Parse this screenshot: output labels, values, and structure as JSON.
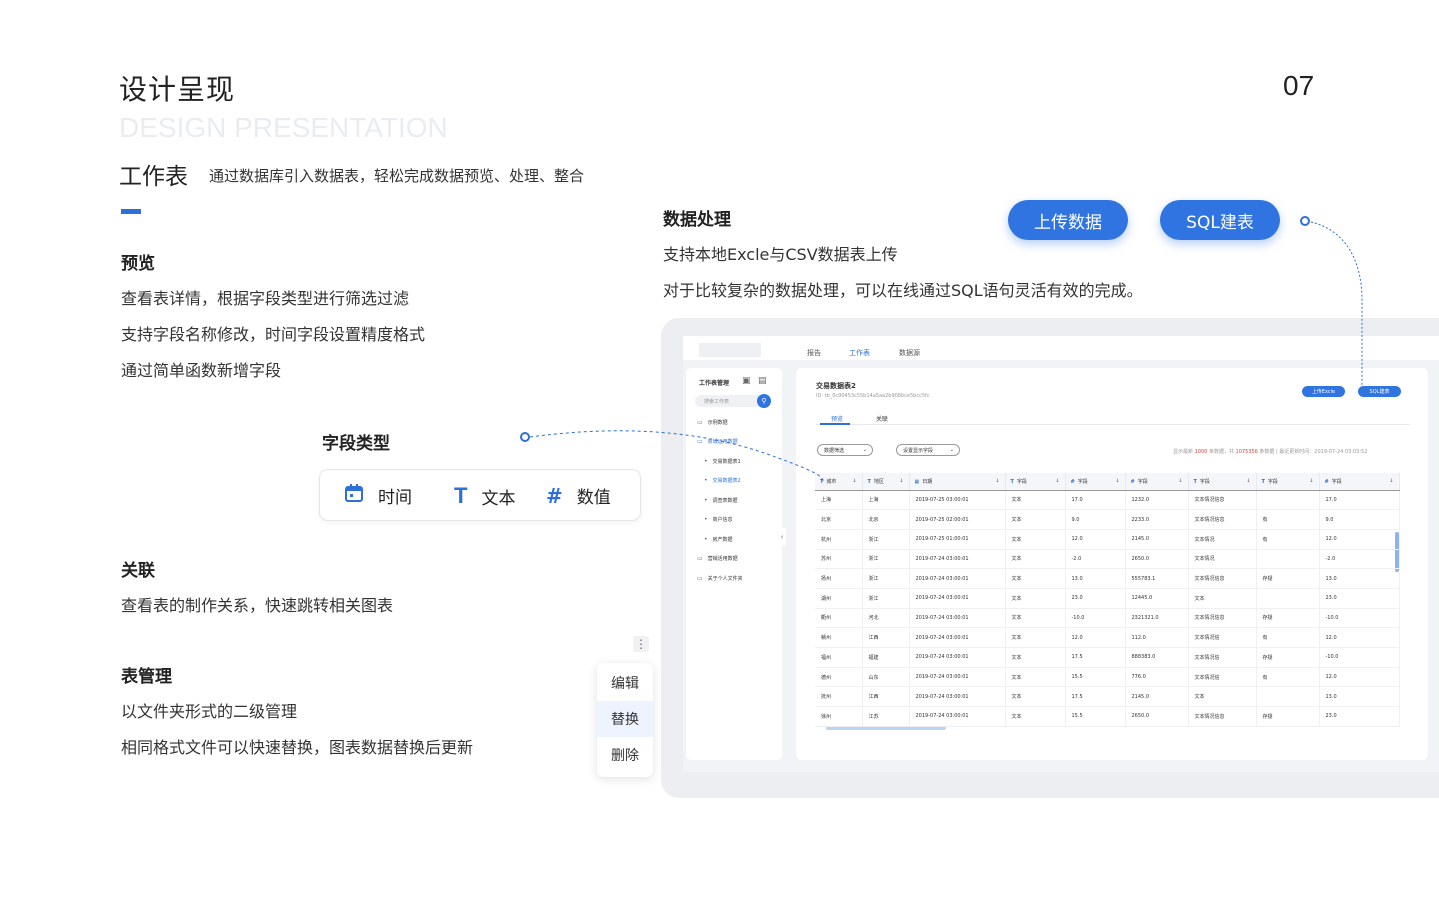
{
  "header": {
    "title_cn": "设计呈现",
    "title_en": "DESIGN PRESENTATION",
    "page_number": "07",
    "subtitle": "工作表",
    "subtitle_desc": "通过数据库引入数据表，轻松完成数据预览、处理、整合"
  },
  "preview": {
    "heading": "预览",
    "lines": [
      "查看表详情，根据字段类型进行筛选过滤",
      "支持字段名称修改，时间字段设置精度格式",
      "通过简单函数新增字段"
    ]
  },
  "field_types": {
    "heading": "字段类型",
    "items": [
      {
        "icon": "calendar-icon",
        "label": "时间"
      },
      {
        "icon": "text-type-icon",
        "glyph": "T",
        "label": "文本"
      },
      {
        "icon": "hash-icon",
        "glyph": "#",
        "label": "数值"
      }
    ]
  },
  "relation": {
    "heading": "关联",
    "lines": [
      "查看表的制作关系，快速跳转相关图表"
    ]
  },
  "management": {
    "heading": "表管理",
    "lines": [
      "以文件夹形式的二级管理",
      "相同格式文件可以快速替换，图表数据替换后更新"
    ]
  },
  "context_menu": {
    "more_glyph": "⋮",
    "items": [
      "编辑",
      "替换",
      "删除"
    ],
    "selected": "替换"
  },
  "processing": {
    "heading": "数据处理",
    "lines": [
      "支持本地Excle与CSV数据表上传",
      "对于比较复杂的数据处理，可以在线通过SQL语句灵活有效的完成。"
    ],
    "upload_button": "上传数据",
    "sql_button": "SQL建表"
  },
  "app": {
    "nav_tabs": [
      "报告",
      "工作表",
      "数据源"
    ],
    "active_tab": "工作表",
    "sidebar": {
      "title": "工作表管理",
      "search_placeholder": "搜索工作表",
      "items": [
        {
          "label": "示例数据",
          "level": 0,
          "active": false
        },
        {
          "label": "商城运用数据",
          "level": 0,
          "active": true
        },
        {
          "label": "交易数据表1",
          "level": 1,
          "active": false
        },
        {
          "label": "交易数据表2",
          "level": 1,
          "active": true
        },
        {
          "label": "调查表数据",
          "level": 1,
          "active": false
        },
        {
          "label": "商户信息",
          "level": 1,
          "active": false
        },
        {
          "label": "房产数据",
          "level": 1,
          "active": false
        },
        {
          "label": "营销活用数据",
          "level": 0,
          "active": false
        },
        {
          "label": "关于个人文件夹",
          "level": 0,
          "active": false
        }
      ]
    },
    "table_title": "交易数据表2",
    "table_id": "ID: tb_0c90453c55b14a5aa2b908bce5bcc5fc",
    "upload_excel": "上传Excle",
    "sql_build": "SQL建表",
    "sub_tabs": [
      "预览",
      "关联"
    ],
    "filter_label": "数据筛选",
    "display_fields_label": "设置显示字段",
    "stats": {
      "prefix": "显示最新",
      "shown": "1000",
      "mid": "条数据，共",
      "total": "1075356",
      "suffix": "条数据 | 最近更新时间：2019-07-24 03:03:52"
    },
    "columns": [
      {
        "type": "T",
        "name": "城市"
      },
      {
        "type": "T",
        "name": "地区"
      },
      {
        "type": "cal",
        "name": "日期"
      },
      {
        "type": "T",
        "name": "字段"
      },
      {
        "type": "#",
        "name": "字段"
      },
      {
        "type": "#",
        "name": "字段"
      },
      {
        "type": "T",
        "name": "字段"
      },
      {
        "type": "T",
        "name": "字段"
      },
      {
        "type": "#",
        "name": "字段"
      }
    ],
    "rows": [
      [
        "上海",
        "上海",
        "2019-07-25 03:00:01",
        "文本",
        "17.0",
        "1232.0",
        "文本情况信息",
        "",
        "17.0"
      ],
      [
        "北京",
        "北京",
        "2019-07-25 02:00:01",
        "文本",
        "9.0",
        "2233.0",
        "文本情况信息",
        "有",
        "9.0"
      ],
      [
        "杭州",
        "浙江",
        "2019-07-25 01:00:01",
        "文本",
        "12.0",
        "2145.0",
        "文本情况",
        "有",
        "12.0"
      ],
      [
        "苏州",
        "浙江",
        "2019-07-24 03:00:01",
        "文本",
        "-2.0",
        "2650.0",
        "文本情况",
        "",
        "-2.0"
      ],
      [
        "扬州",
        "浙江",
        "2019-07-24 03:00:01",
        "文本",
        "13.0",
        "555783.1",
        "文本情况信息",
        "存疑",
        "13.0"
      ],
      [
        "湖州",
        "浙江",
        "2019-07-24 03:00:01",
        "文本",
        "23.0",
        "12445.0",
        "文本",
        "",
        "23.0"
      ],
      [
        "衢州",
        "河北",
        "2019-07-24 03:00:01",
        "文本",
        "-10.0",
        "2321321.0",
        "文本情况信息",
        "存疑",
        "-10.0"
      ],
      [
        "赣州",
        "江西",
        "2019-07-24 03:00:01",
        "文本",
        "12.0",
        "112.0",
        "文本情况信",
        "有",
        "12.0"
      ],
      [
        "福州",
        "福建",
        "2019-07-24 03:00:01",
        "文本",
        "17.5",
        "888383.0",
        "文本情况信",
        "存疑",
        "-10.0"
      ],
      [
        "德州",
        "山东",
        "2019-07-24 03:00:01",
        "文本",
        "15.5",
        "776.0",
        "文本情况信",
        "有",
        "12.0"
      ],
      [
        "抚州",
        "江西",
        "2019-07-24 03:00:01",
        "文本",
        "17.5",
        "2145.0",
        "文本",
        "",
        "13.0"
      ],
      [
        "徐州",
        "江苏",
        "2019-07-24 03:00:01",
        "文本",
        "15.5",
        "2650.0",
        "文本情况信息",
        "存疑",
        "23.0"
      ]
    ]
  },
  "colors": {
    "accent": "#2f6fd8",
    "pill": "#2f74e0",
    "highlight_number": "#e0443a"
  }
}
